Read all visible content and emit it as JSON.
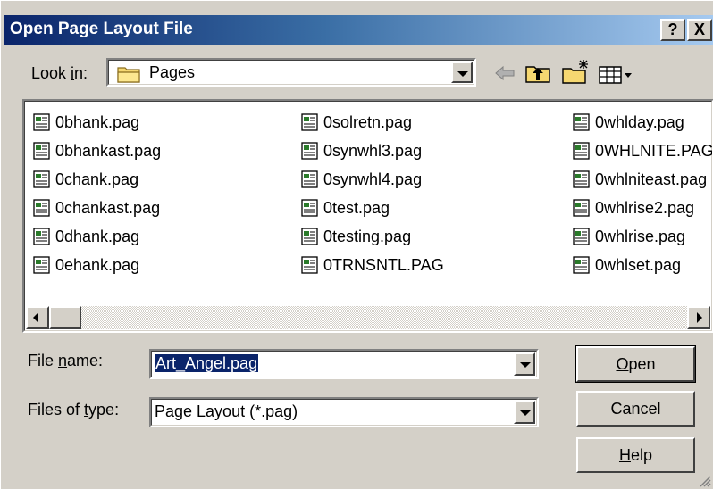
{
  "window": {
    "title": "Open Page Layout File",
    "help_glyph": "?",
    "close_glyph": "X"
  },
  "look_in": {
    "label_pre": "Look ",
    "label_key": "i",
    "label_post": "n:",
    "value": "Pages",
    "icon": "folder-icon"
  },
  "toolbar": {
    "icons": [
      "back-arrow-icon",
      "up-folder-icon",
      "new-folder-icon",
      "view-menu-icon"
    ]
  },
  "files": {
    "col1": [
      "0bhank.pag",
      "0bhankast.pag",
      "0chank.pag",
      "0chankast.pag",
      "0dhank.pag",
      "0ehank.pag"
    ],
    "col2": [
      "0solretn.pag",
      "0synwhl3.pag",
      "0synwhl4.pag",
      "0test.pag",
      "0testing.pag",
      "0TRNSNTL.PAG"
    ],
    "col3": [
      "0whlday.pag",
      "0WHLNITE.PAG",
      "0whlniteast.pag",
      "0whlrise2.pag",
      "0whlrise.pag",
      "0whlset.pag"
    ]
  },
  "file_name": {
    "label_pre": "File ",
    "label_key": "n",
    "label_post": "ame:",
    "value": "Art_Angel.pag"
  },
  "file_type": {
    "label_pre": "Files of ",
    "label_key": "t",
    "label_post": "ype:",
    "value": "Page Layout (*.pag)"
  },
  "buttons": {
    "open_key": "O",
    "open_rest": "pen",
    "cancel": "Cancel",
    "help_key": "H",
    "help_rest": "elp"
  }
}
